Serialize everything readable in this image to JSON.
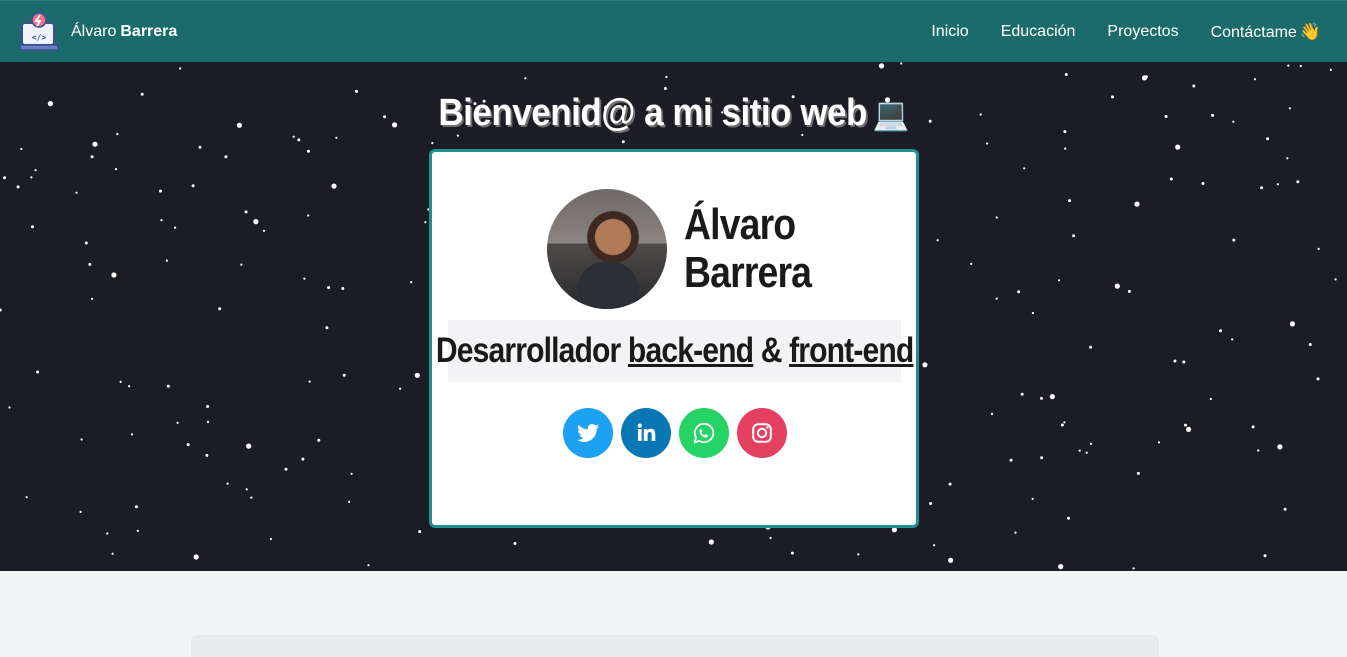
{
  "nav": {
    "brand_first": "Álvaro",
    "brand_last": "Barrera",
    "links": [
      "Inicio",
      "Educación",
      "Proyectos",
      "Contáctame"
    ],
    "contact_emoji": "👋"
  },
  "hero": {
    "title": "Bienvenid@ a mi sitio web",
    "title_emoji": "💻"
  },
  "card": {
    "name_line1": "Álvaro",
    "name_line2": "Barrera",
    "subtitle_prefix": "Desarrollador",
    "subtitle_link1": "back-end",
    "subtitle_amp": "&",
    "subtitle_link2": "front-end",
    "socials": [
      {
        "icon": "twitter-icon",
        "color": "#1da1f2"
      },
      {
        "icon": "linkedin-icon",
        "color": "#0a77b5"
      },
      {
        "icon": "whatsapp-icon",
        "color": "#25d366"
      },
      {
        "icon": "instagram-icon",
        "color": "#e4405f"
      }
    ]
  },
  "colors": {
    "navbar": "#1b6b6d",
    "hero_bg": "#1c1c26",
    "card_border": "#1f8f8f",
    "page_bg": "#f3f4f6"
  }
}
